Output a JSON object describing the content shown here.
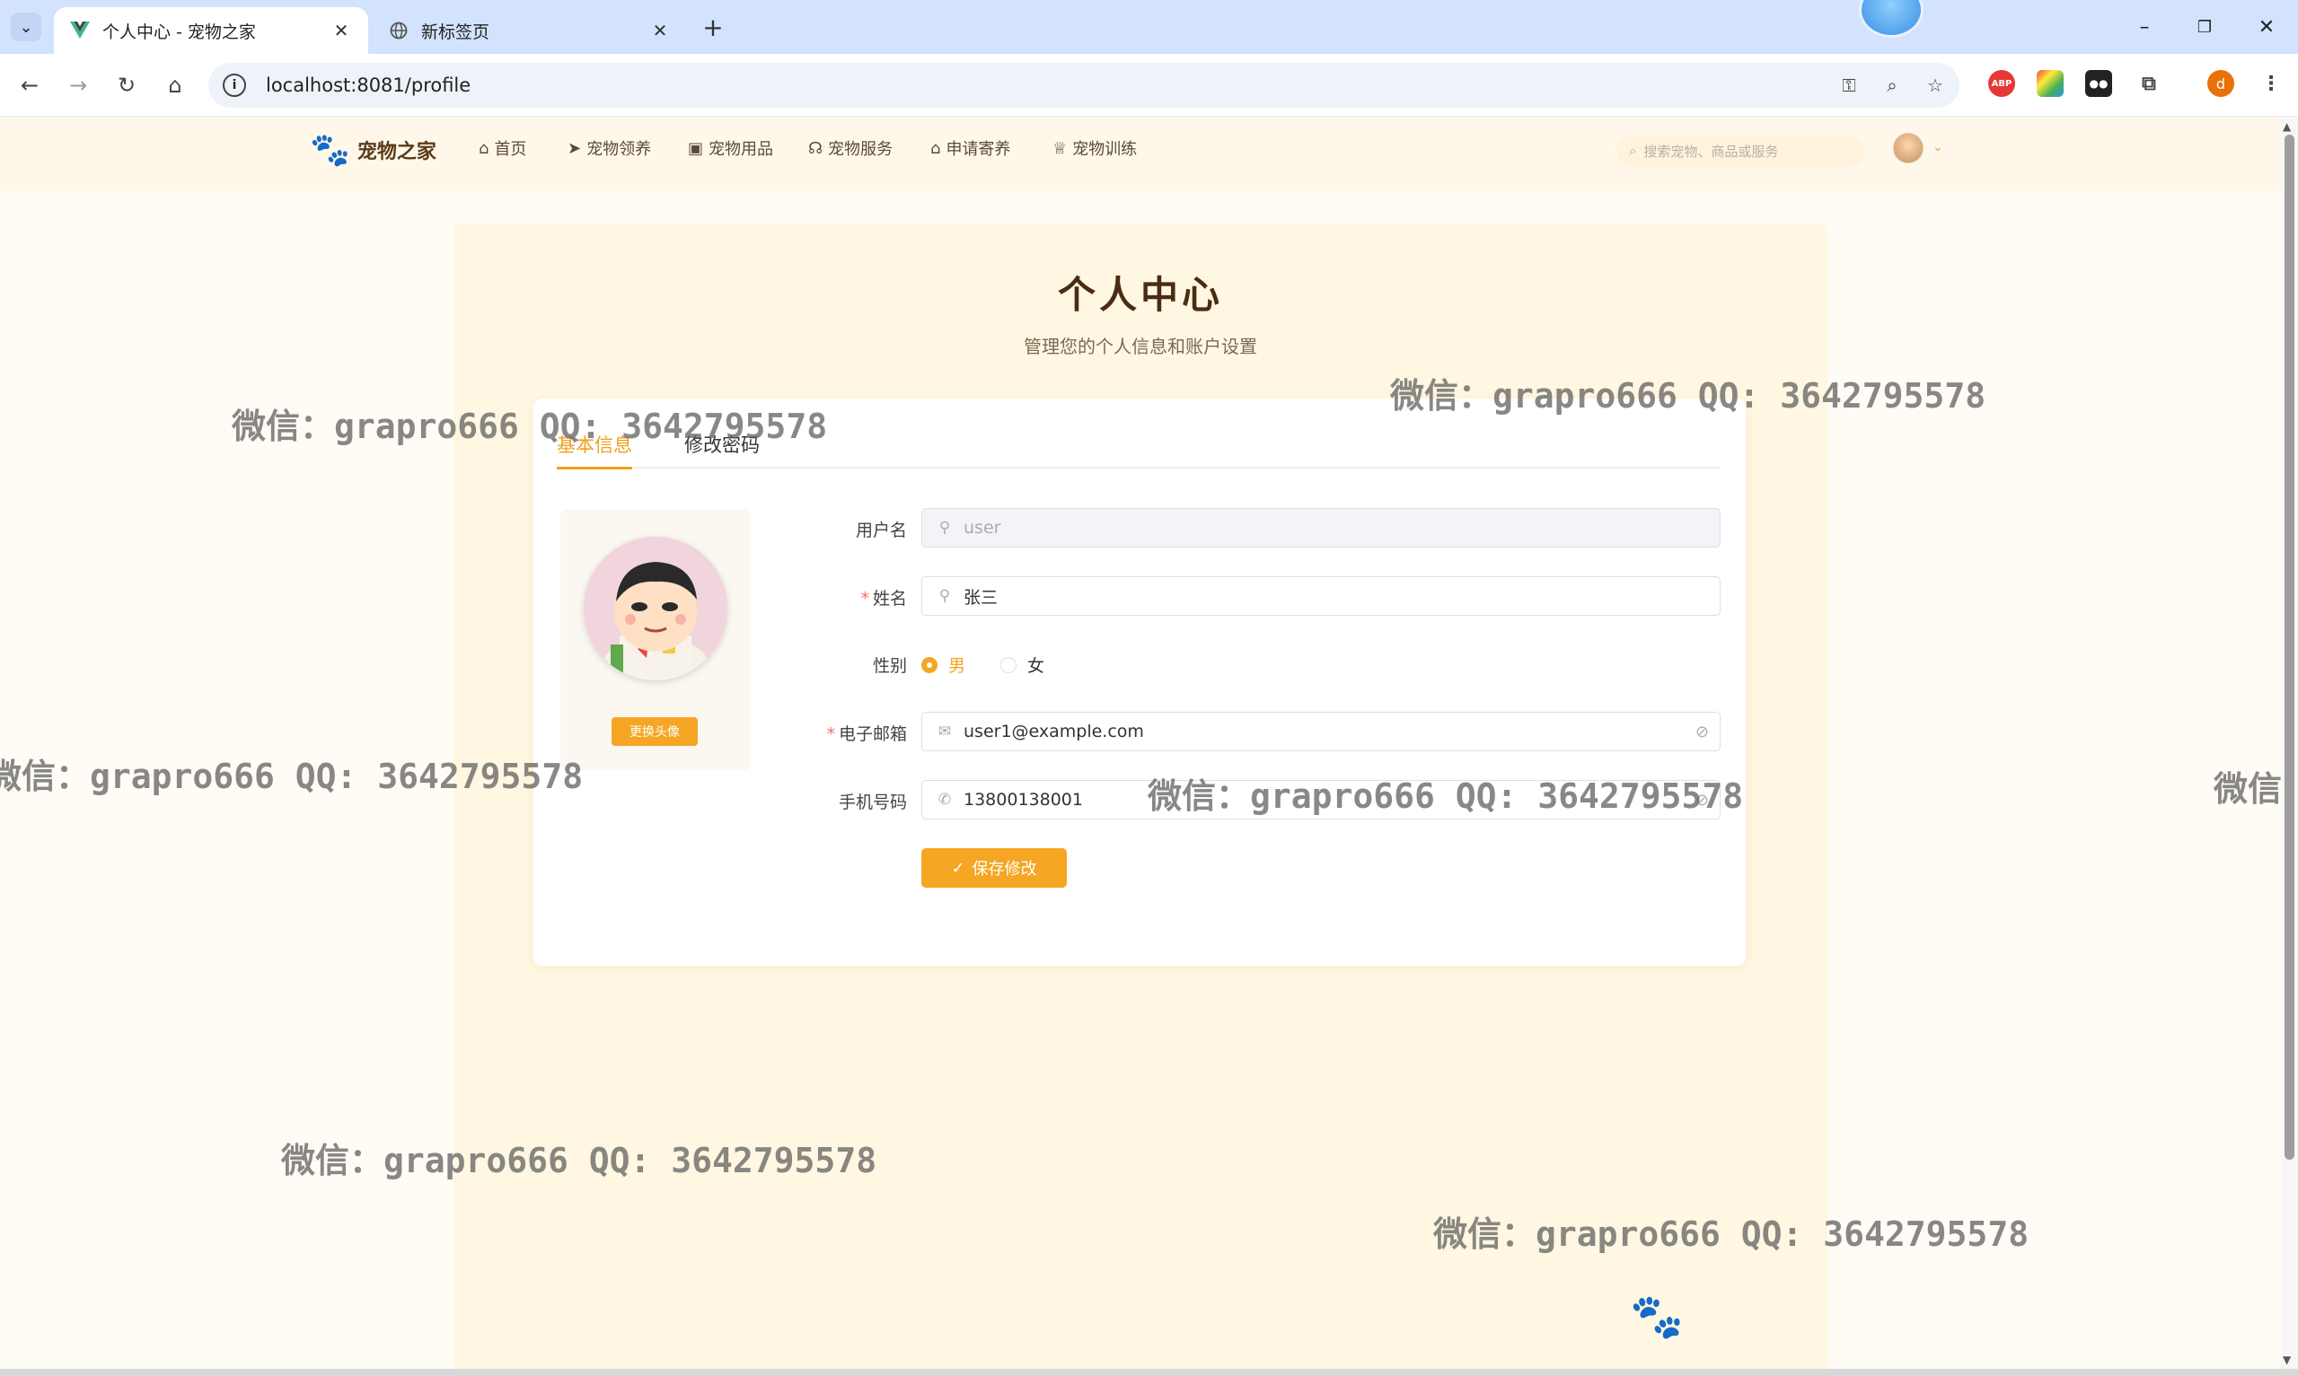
{
  "browser": {
    "tabs": [
      {
        "title": "个人中心 - 宠物之家",
        "active": true
      },
      {
        "title": "新标签页",
        "active": false
      }
    ],
    "new_tab": "+",
    "url": "localhost:8081/profile",
    "window_controls": {
      "minimize": "–",
      "restore": "❐",
      "close": "✕"
    },
    "profile_initial": "d"
  },
  "site": {
    "logo_text": "宠物之家",
    "nav": [
      {
        "label": "首页",
        "icon": "home-icon"
      },
      {
        "label": "宠物领养",
        "icon": "send-icon"
      },
      {
        "label": "宠物用品",
        "icon": "bag-icon"
      },
      {
        "label": "宠物服务",
        "icon": "headset-icon"
      },
      {
        "label": "申请寄养",
        "icon": "house-icon"
      },
      {
        "label": "宠物训练",
        "icon": "trophy-icon"
      }
    ],
    "search_placeholder": "搜索宠物、商品或服务"
  },
  "page": {
    "title": "个人中心",
    "subtitle": "管理您的个人信息和账户设置",
    "tabs": [
      {
        "label": "基本信息",
        "active": true
      },
      {
        "label": "修改密码",
        "active": false
      }
    ],
    "change_avatar_label": "更换头像",
    "form": {
      "username": {
        "label": "用户名",
        "value": "user",
        "disabled": true
      },
      "name": {
        "label": "姓名",
        "value": "张三",
        "required": true
      },
      "gender": {
        "label": "性别",
        "options": [
          "男",
          "女"
        ],
        "selected": "男"
      },
      "email": {
        "label": "电子邮箱",
        "value": "user1@example.com",
        "required": true
      },
      "phone": {
        "label": "手机号码",
        "value": "13800138001"
      }
    },
    "save_label": "保存修改"
  },
  "watermark_text": "微信：grapro666 QQ: 3642795578",
  "colors": {
    "accent": "#f5a623",
    "tab_active": "#f0a020",
    "header_bg": "#fff8ea",
    "title": "#4a2c12"
  }
}
